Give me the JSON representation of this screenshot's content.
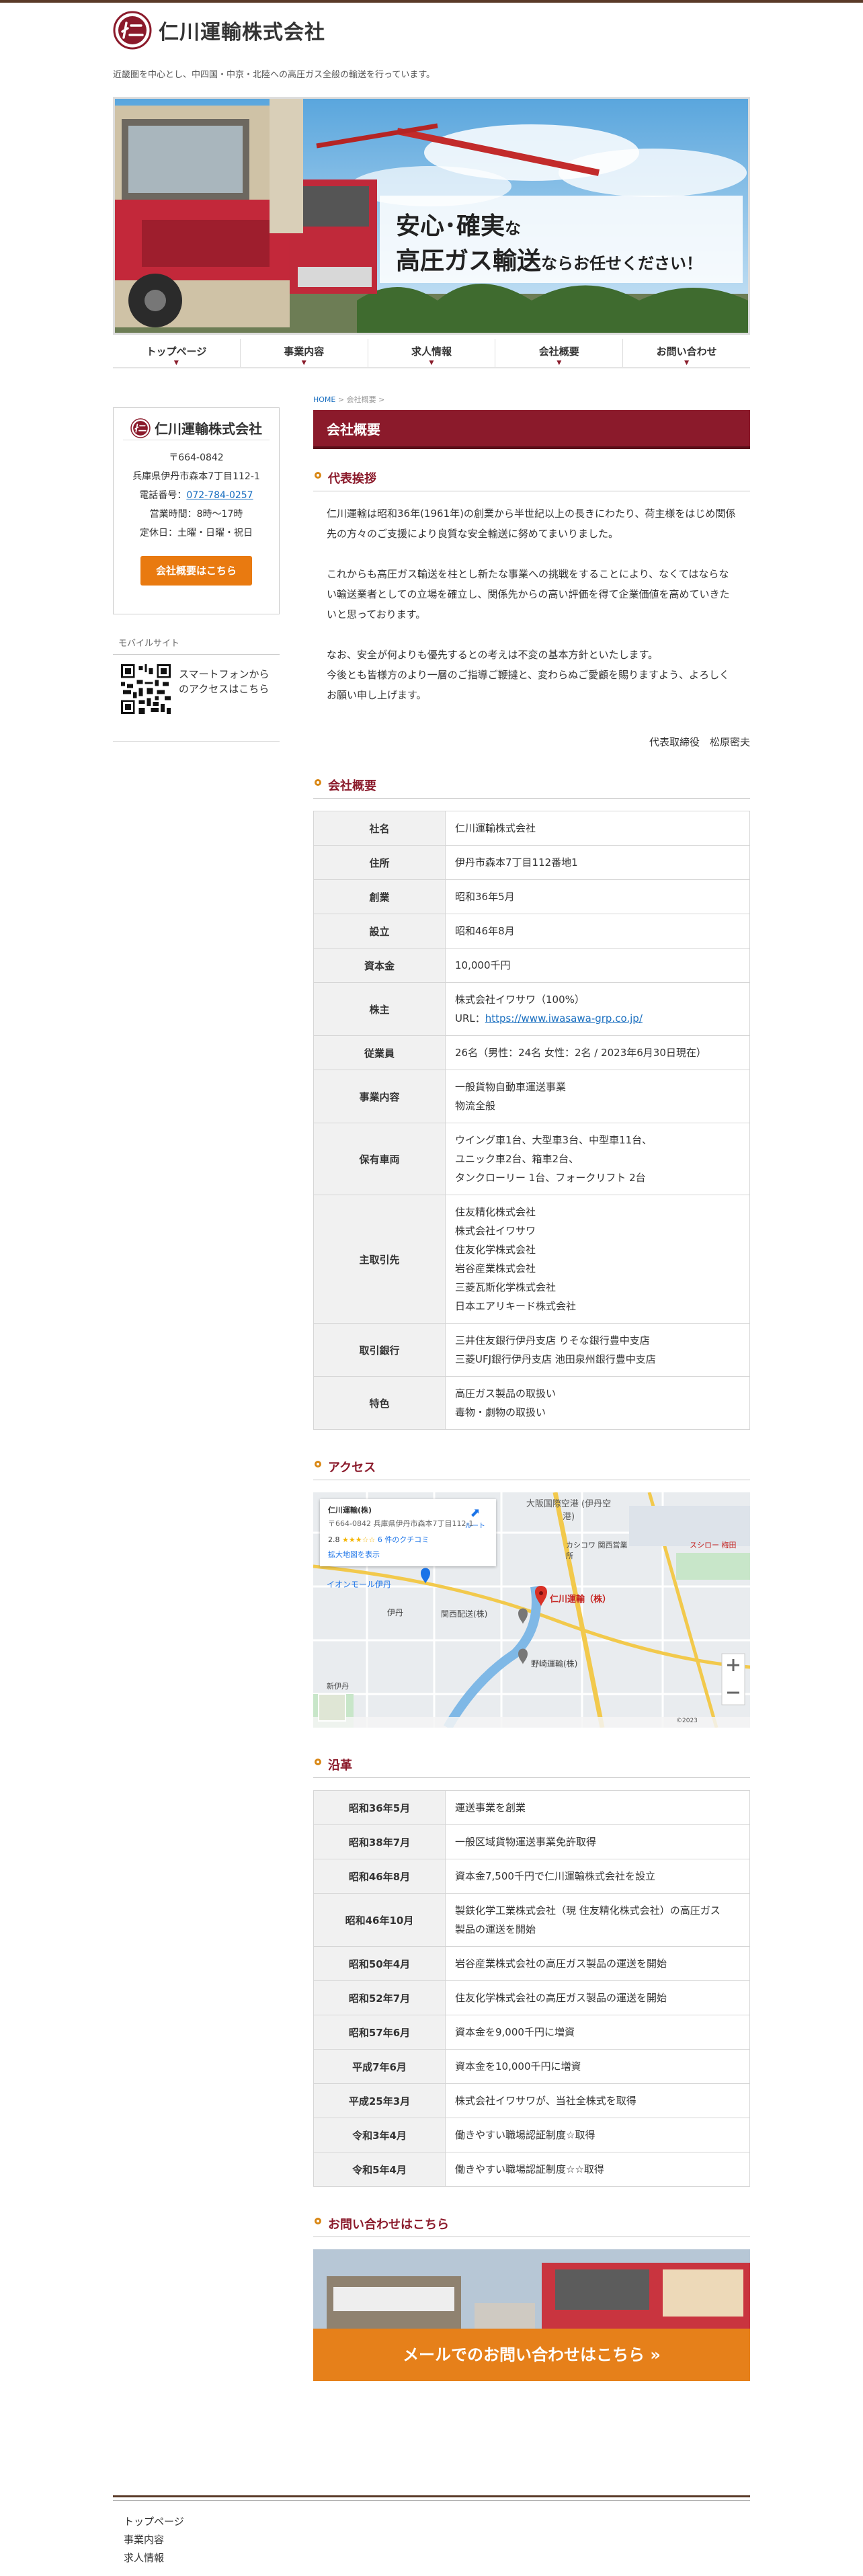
{
  "header": {
    "company_name": "仁川運輸株式会社",
    "tagline": "近畿圏を中心とし、中四国・中京・北陸への高圧ガス全般の輸送を行っています。"
  },
  "hero": {
    "line1_a": "安心",
    "line1_dot": "･",
    "line1_b": "確実",
    "line1_c": "な",
    "line2_a": "高圧ガス輸送",
    "line2_b": "ならお任せください！"
  },
  "gnav": [
    "トップページ",
    "事業内容",
    "求人情報",
    "会社概要",
    "お問い合わせ"
  ],
  "breadcrumb": {
    "home": "HOME",
    "sep": " > ",
    "current": "会社概要",
    "end": " >"
  },
  "page_title": "会社概要",
  "sidebar": {
    "card_name": "仁川運輸株式会社",
    "postal": "〒664-0842",
    "address": "兵庫県伊丹市森本7丁目112-1",
    "tel_label": "電話番号：",
    "tel": "072-784-0257",
    "hours": "営業時間：8時〜17時",
    "holiday": "定休日：土曜・日曜・祝日",
    "button": "会社概要はこちら",
    "mobile_head": "モバイルサイト",
    "mobile_text": "スマートフォンからのアクセスはこちら"
  },
  "greeting": {
    "heading": "代表挨拶",
    "p1": "仁川運輸は昭和36年(1961年)の創業から半世紀以上の長きにわたり、荷主様をはじめ関係先の方々のご支援により良質な安全輸送に努めてまいりました。",
    "p2": "これからも高圧ガス輸送を柱とし新たな事業への挑戦をすることにより、なくてはならない輸送業者としての立場を確立し、関係先からの高い評価を得て企業価値を高めていきたいと思っております。",
    "p3": "なお、安全が何よりも優先するとの考えは不変の基本方針といたします。",
    "p4": "今後とも皆様方のより一層のご指導ご鞭撻と、変わらぬご愛顧を賜りますよう、よろしくお願い申し上げます。",
    "signature": "代表取締役　松原密夫"
  },
  "overview": {
    "heading": "会社概要",
    "rows": [
      {
        "k": "社名",
        "v": [
          "仁川運輸株式会社"
        ]
      },
      {
        "k": "住所",
        "v": [
          "伊丹市森本7丁目112番地1"
        ]
      },
      {
        "k": "創業",
        "v": [
          "昭和36年5月"
        ]
      },
      {
        "k": "設立",
        "v": [
          "昭和46年8月"
        ]
      },
      {
        "k": "資本金",
        "v": [
          "10,000千円"
        ]
      },
      {
        "k": "株主",
        "v": [
          "株式会社イワサワ（100%）"
        ],
        "url_label": "URL：",
        "url": "https://www.iwasawa-grp.co.jp/"
      },
      {
        "k": "従業員",
        "v": [
          "26名（男性：24名 女性：2名 / 2023年6月30日現在）"
        ]
      },
      {
        "k": "事業内容",
        "v": [
          "一般貨物自動車運送事業",
          "物流全般"
        ]
      },
      {
        "k": "保有車両",
        "v": [
          "ウイング車1台、大型車3台、中型車11台、",
          "ユニック車2台、箱車2台、",
          "タンクローリー 1台、フォークリフト 2台"
        ]
      },
      {
        "k": "主取引先",
        "v": [
          "住友精化株式会社",
          "株式会社イワサワ",
          "住友化学株式会社",
          "岩谷産業株式会社",
          "三菱瓦斯化学株式会社",
          "日本エアリキード株式会社"
        ]
      },
      {
        "k": "取引銀行",
        "v": [
          "三井住友銀行伊丹支店 りそな銀行豊中支店",
          "三菱UFJ銀行伊丹支店 池田泉州銀行豊中支店"
        ]
      },
      {
        "k": "特色",
        "v": [
          "高圧ガス製品の取扱い",
          "毒物・劇物の取扱い"
        ]
      }
    ]
  },
  "access": {
    "heading": "アクセス",
    "map_pin": "仁川運輸（株）",
    "map_card_title": "仁川運輸(株)",
    "map_card_addr": "〒664-0842 兵庫県伊丹市森本7丁目112-1",
    "map_rating": "2.8",
    "map_reviews": "6 件のクチコミ",
    "map_route": "ルート",
    "map_large": "拡大地図を表示",
    "labels": [
      "大阪国際空港 (伊丹空港)",
      "イオンモール伊丹",
      "伊丹",
      "関西配送(株)",
      "野崎運輸(株)",
      "カシコワ 関西営業所",
      "スシロー 梅田",
      "新伊丹"
    ],
    "copyright": "©2023"
  },
  "history": {
    "heading": "沿革",
    "rows": [
      {
        "k": "昭和36年5月",
        "v": [
          "運送事業を創業"
        ]
      },
      {
        "k": "昭和38年7月",
        "v": [
          "一般区域貨物運送事業免許取得"
        ]
      },
      {
        "k": "昭和46年8月",
        "v": [
          "資本金7,500千円で仁川運輸株式会社を設立"
        ]
      },
      {
        "k": "昭和46年10月",
        "v": [
          "製鉄化学工業株式会社（現 住友精化株式会社）の高圧ガス",
          "製品の運送を開始"
        ]
      },
      {
        "k": "昭和50年4月",
        "v": [
          "岩谷産業株式会社の高圧ガス製品の運送を開始"
        ]
      },
      {
        "k": "昭和52年7月",
        "v": [
          "住友化学株式会社の高圧ガス製品の運送を開始"
        ]
      },
      {
        "k": "昭和57年6月",
        "v": [
          "資本金を9,000千円に増資"
        ]
      },
      {
        "k": "平成7年6月",
        "v": [
          "資本金を10,000千円に増資"
        ]
      },
      {
        "k": "平成25年3月",
        "v": [
          "株式会社イワサワが、当社全株式を取得"
        ]
      },
      {
        "k": "令和3年4月",
        "v": [
          "働きやすい職場認証制度☆取得"
        ]
      },
      {
        "k": "令和5年4月",
        "v": [
          "働きやすい職場認証制度☆☆取得"
        ]
      }
    ]
  },
  "contact": {
    "heading": "お問い合わせはこちら",
    "cta": "メールでのお問い合わせはこちら »"
  },
  "footer": [
    "トップページ",
    "事業内容",
    "求人情報"
  ],
  "colors": {
    "brand": "#8b1a2b",
    "accent": "#e97a10",
    "link": "#1a6fc0"
  }
}
